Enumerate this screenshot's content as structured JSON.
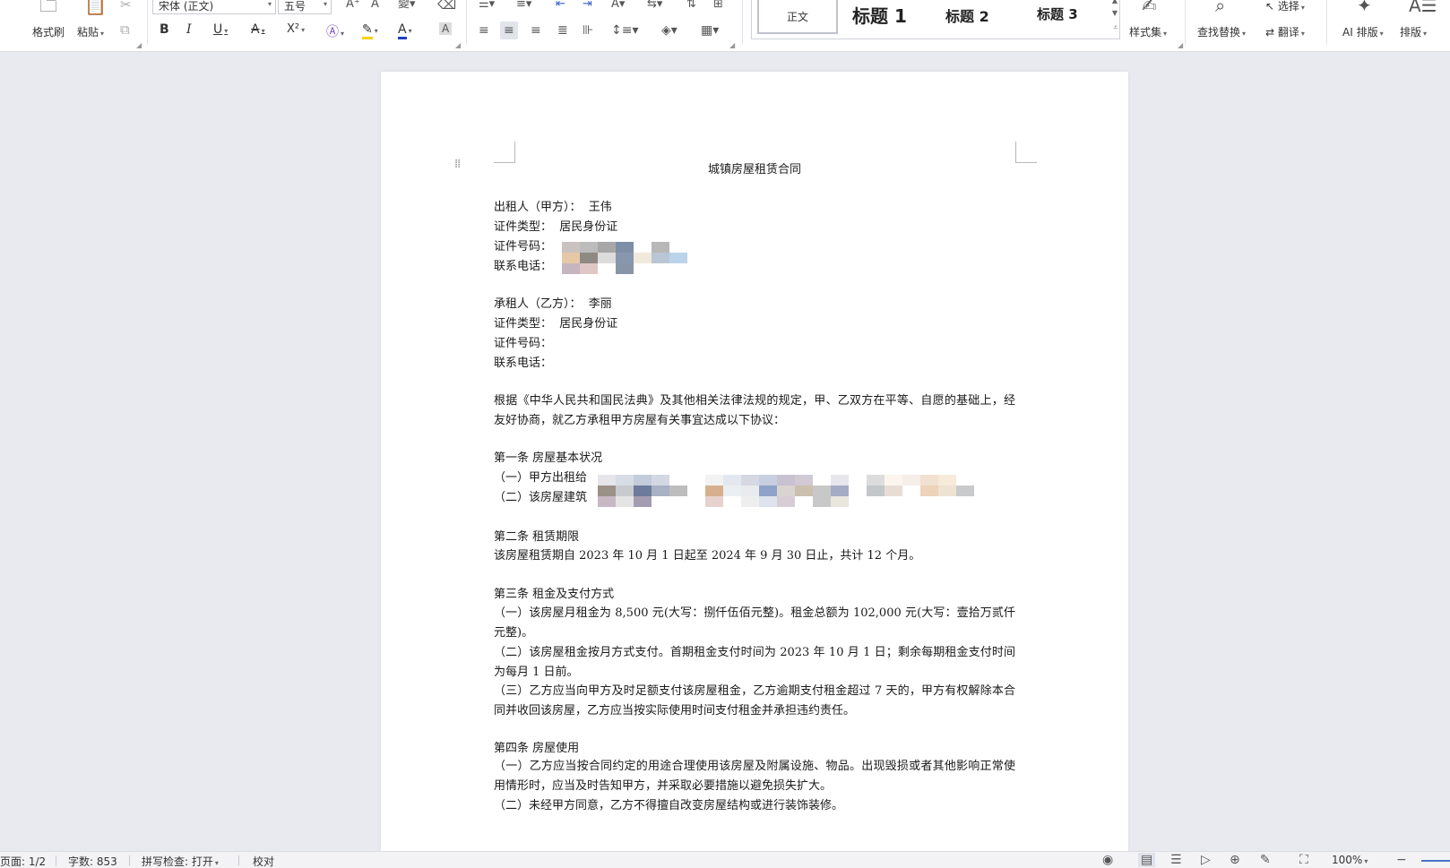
{
  "ribbon": {
    "format_painter": "格式刷",
    "paste": "粘贴",
    "font_name": "宋体 (正文)",
    "font_size": "五号",
    "styles": {
      "normal": "正文",
      "h1": "标题 1",
      "h2": "标题 2",
      "h3": "标题 3"
    },
    "style_set": "样式集",
    "find_replace": "查找替换",
    "select": "选择",
    "translate": "翻译",
    "ai_layout": "AI 排版",
    "layout": "排版",
    "format_buttons": {
      "bold": "B",
      "italic": "I",
      "underline": "U",
      "strike": "A",
      "superscript": "X²",
      "font_color": "A",
      "char_shading": "A"
    },
    "colors": {
      "highlight": "#f5d300",
      "font_color": "#1f3fbf"
    }
  },
  "document": {
    "title": "城镇房屋租赁合同",
    "lessor": {
      "label": "出租人（甲方）：",
      "name": "王伟",
      "id_type_label": "证件类型：",
      "id_type": "居民身份证",
      "id_no_label": "证件号码：",
      "phone_label": "联系电话："
    },
    "lessee": {
      "label": "承租人（乙方）：",
      "name": "李丽",
      "id_type_label": "证件类型：",
      "id_type": "居民身份证",
      "id_no_label": "证件号码：",
      "phone_label": "联系电话："
    },
    "preamble": "根据《中华人民共和国民法典》及其他相关法律法规的规定，甲、乙双方在平等、自愿的基础上，经友好协商，就乙方承租甲方房屋有关事宜达成以下协议：",
    "article1": {
      "heading": "第一条  房屋基本状况",
      "item1": "（一）甲方出租给",
      "item2": "（二）该房屋建筑"
    },
    "article2": {
      "heading": "第二条  租赁期限",
      "text": "该房屋租赁期自 2023 年 10 月 1 日起至 2024 年 9 月 30 日止，共计 12 个月。"
    },
    "article3": {
      "heading": "第三条  租金及支付方式",
      "item1": "（一）该房屋月租金为 8,500 元(大写：捌仟伍佰元整)。租金总额为 102,000 元(大写：壹拾万贰仟元整)。",
      "item2": "（二）该房屋租金按月方式支付。首期租金支付时间为 2023 年 10 月 1 日；剩余每期租金支付时间为每月 1 日前。",
      "item3": "（三）乙方应当向甲方及时足额支付该房屋租金，乙方逾期支付租金超过 7 天的，甲方有权解除本合同并收回该房屋，乙方应当按实际使用时间支付租金并承担违约责任。"
    },
    "article4": {
      "heading": "第四条  房屋使用",
      "item1": "（一）乙方应当按合同约定的用途合理使用该房屋及附属设施、物品。出现毁损或者其他影响正常使用情形时，应当及时告知甲方，并采取必要措施以避免损失扩大。",
      "item2": "（二）未经甲方同意，乙方不得擅自改变房屋结构或进行装饰装修。"
    }
  },
  "statusbar": {
    "page": "页面: 1/2",
    "word_count": "字数: 853",
    "spell_check": "拼写检查: 打开",
    "proofread": "校对",
    "zoom": "100%"
  }
}
